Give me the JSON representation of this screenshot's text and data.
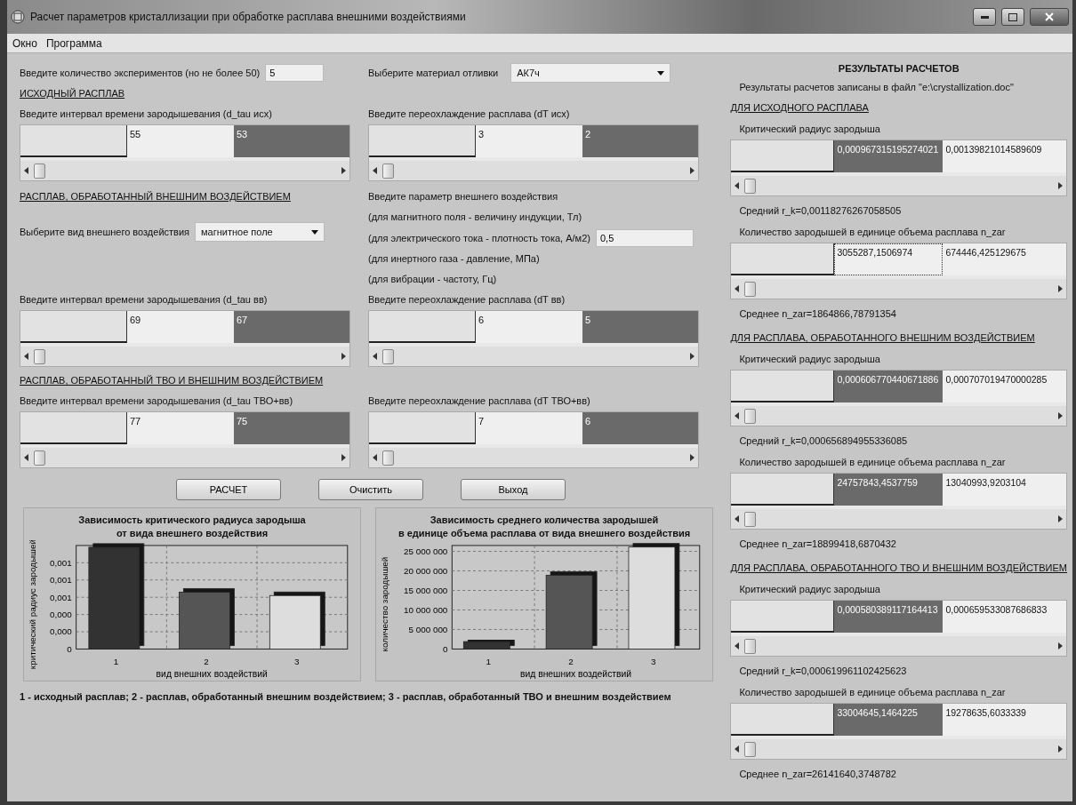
{
  "window": {
    "title": "Расчет параметров кристаллизации при обработке расплава внешними воздействиями"
  },
  "menu": [
    {
      "label": "Окно"
    },
    {
      "label": "Программа"
    }
  ],
  "experiments": {
    "label": "Введите количество экспериментов (но не более 50)",
    "value": "5"
  },
  "material": {
    "label": "Выберите материал отливки",
    "value": "АК7ч"
  },
  "initial_melt": {
    "heading": "ИСХОДНЫЙ РАСПЛАВ",
    "tau": {
      "label": "Введите интервал времени зародышевания (d_tau исх)",
      "cells": [
        {
          "text": "55",
          "selected": false,
          "focused": false
        },
        {
          "text": "53",
          "selected": true,
          "focused": false
        }
      ]
    },
    "dt": {
      "label": "Введите переохлаждение расплава (dT исх)",
      "cells": [
        {
          "text": "3",
          "selected": false,
          "focused": false
        },
        {
          "text": "2",
          "selected": true,
          "focused": false
        }
      ]
    }
  },
  "treated_melt": {
    "heading": "РАСПЛАВ, ОБРАБОТАННЫЙ ВНЕШНИМ ВОЗДЕЙСТВИЕМ",
    "effect": {
      "label": "Выберите вид внешнего воздействия",
      "value": "магнитное поле"
    },
    "parameter": {
      "lines": [
        "Введите параметр внешнего воздействия",
        "(для магнитного поля - величину индукции, Тл)",
        "(для электрического тока - плотность тока, А/м2)",
        "(для инертного газа - давление, МПа)",
        "(для вибрации - частоту, Гц)"
      ],
      "value": "0,5"
    },
    "tau": {
      "label": "Введите интервал времени зародышевания (d_tau вв)",
      "cells": [
        {
          "text": "69",
          "selected": false,
          "focused": false
        },
        {
          "text": "67",
          "selected": true,
          "focused": false
        }
      ]
    },
    "dt": {
      "label": "Введите переохлаждение расплава (dT вв)",
      "cells": [
        {
          "text": "6",
          "selected": false,
          "focused": false
        },
        {
          "text": "5",
          "selected": true,
          "focused": false
        }
      ]
    }
  },
  "tvo_melt": {
    "heading": "РАСПЛАВ, ОБРАБОТАННЫЙ ТВО И ВНЕШНИМ ВОЗДЕЙСТВИЕМ",
    "tau": {
      "label": "Введите интервал времени зародышевания (d_tau ТВО+вв)",
      "cells": [
        {
          "text": "77",
          "selected": false,
          "focused": false
        },
        {
          "text": "75",
          "selected": true,
          "focused": false
        }
      ]
    },
    "dt": {
      "label": "Введите переохлаждение расплава (dT ТВО+вв)",
      "cells": [
        {
          "text": "7",
          "selected": false,
          "focused": false
        },
        {
          "text": "6",
          "selected": true,
          "focused": false
        }
      ]
    }
  },
  "buttons": [
    {
      "label": "РАСЧЕТ"
    },
    {
      "label": "Очистить"
    },
    {
      "label": "Выход"
    }
  ],
  "charts": [
    {
      "chart_data": {
        "type": "bar",
        "title": "Зависимость критического радиуса зародыша\nот вида внешнего воздействия",
        "xlabel": "вид внешних воздействий",
        "ylabel": "критический радиус зародышей",
        "categories": [
          "1",
          "2",
          "3"
        ],
        "grid": true,
        "series": [
          {
            "color": "#333333",
            "values": [
              0.00118,
              null,
              null
            ]
          },
          {
            "color": "#555555",
            "values": [
              null,
              0.00066,
              null
            ]
          },
          {
            "color": "#dddddd",
            "values": [
              null,
              null,
              0.00062
            ]
          }
        ],
        "ylim": [
          0,
          0.0012
        ],
        "yticks": [
          {
            "value": 0,
            "label": "0"
          },
          {
            "value": 0.0002,
            "label": "0,000"
          },
          {
            "value": 0.0004,
            "label": "0,000"
          },
          {
            "value": 0.0006,
            "label": "0,001"
          },
          {
            "value": 0.0008,
            "label": "0,001"
          },
          {
            "value": 0.001,
            "label": "0,001"
          }
        ]
      }
    },
    {
      "chart_data": {
        "type": "bar",
        "title": "Зависимость среднего количества зародышей\nв единице объема расплава от вида внешнего воздействия",
        "xlabel": "вид внешних воздействий",
        "ylabel": "количество зародышей",
        "categories": [
          "1",
          "2",
          "3"
        ],
        "grid": true,
        "series": [
          {
            "color": "#333333",
            "values": [
              1900000,
              null,
              null
            ]
          },
          {
            "color": "#555555",
            "values": [
              null,
              18900000,
              null
            ]
          },
          {
            "color": "#dddddd",
            "values": [
              null,
              null,
              26100000
            ]
          }
        ],
        "ylim": [
          0,
          26500000
        ],
        "yticks": [
          {
            "value": 0,
            "label": "0"
          },
          {
            "value": 5000000,
            "label": "5 000 000"
          },
          {
            "value": 10000000,
            "label": "10 000 000"
          },
          {
            "value": 15000000,
            "label": "15 000 000"
          },
          {
            "value": 20000000,
            "label": "20 000 000"
          },
          {
            "value": 25000000,
            "label": "25 000 000"
          }
        ]
      }
    }
  ],
  "legend": "1 - исходный расплав;  2 - расплав, обработанный внешним воздействием;  3 - расплав, обработанный ТВО и внешним воздействием",
  "results": {
    "heading": "РЕЗУЛЬТАТЫ РАСЧЕТОВ",
    "note": "Результаты расчетов записаны в файл \"e:\\crystallization.doc\"",
    "groups": [
      {
        "heading": "ДЛЯ ИСХОДНОГО РАСПЛАВА",
        "radius_label": "Критический радиус зародыша",
        "radius_cells": [
          {
            "text": "0,000967315195274021",
            "selected": true,
            "focused": false
          },
          {
            "text": "0,00139821014589609",
            "selected": false,
            "focused": false
          }
        ],
        "mean_radius": "Средний r_k=0,00118276267058505",
        "count_label": "Количество зародышей в единице  объема расплава n_zar",
        "count_cells": [
          {
            "text": "3055287,1506974",
            "selected": false,
            "focused": true
          },
          {
            "text": "674446,425129675",
            "selected": false,
            "focused": false
          }
        ],
        "mean_count": "Среднее n_zar=1864866,78791354"
      },
      {
        "heading": "ДЛЯ РАСПЛАВА, ОБРАБОТАННОГО ВНЕШНИМ ВОЗДЕЙСТВИЕМ",
        "radius_label": "Критический радиус зародыша",
        "radius_cells": [
          {
            "text": "0,000606770440671886",
            "selected": true,
            "focused": false
          },
          {
            "text": "0,000707019470000285",
            "selected": false,
            "focused": false
          }
        ],
        "mean_radius": "Средний r_k=0,000656894955336085",
        "count_label": "Количество зародышей в единице  объема расплава n_zar",
        "count_cells": [
          {
            "text": "24757843,4537759",
            "selected": true,
            "focused": false
          },
          {
            "text": "13040993,9203104",
            "selected": false,
            "focused": false
          }
        ],
        "mean_count": "Среднее n_zar=18899418,6870432"
      },
      {
        "heading": "ДЛЯ РАСПЛАВА, ОБРАБОТАННОГО ТВО И ВНЕШНИМ ВОЗДЕЙСТВИЕМ",
        "radius_label": "Критический радиус зародыша",
        "radius_cells": [
          {
            "text": "0,000580389117164413",
            "selected": true,
            "focused": false
          },
          {
            "text": "0,000659533087686833",
            "selected": false,
            "focused": false
          }
        ],
        "mean_radius": "Средний r_k=0,000619961102425623",
        "count_label": "Количество зародышей в единице  объема расплава n_zar",
        "count_cells": [
          {
            "text": "33004645,1464225",
            "selected": true,
            "focused": false
          },
          {
            "text": "19278635,6033339",
            "selected": false,
            "focused": false
          }
        ],
        "mean_count": "Среднее n_zar=26141640,3748782"
      }
    ]
  }
}
